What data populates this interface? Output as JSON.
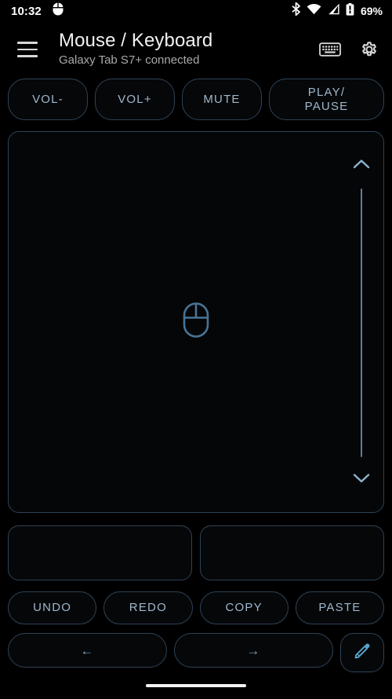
{
  "status_bar": {
    "time": "10:32",
    "battery_percent": "69%",
    "icons": {
      "notification": "mouse-icon",
      "bluetooth": "bluetooth-icon",
      "wifi": "wifi-icon",
      "cellular": "cellular-signal-icon",
      "battery": "battery-icon"
    }
  },
  "app_bar": {
    "menu_icon": "hamburger-menu-icon",
    "title": "Mouse / Keyboard",
    "subtitle": "Galaxy Tab S7+ connected",
    "actions": [
      {
        "name": "keyboard-icon",
        "label": "Keyboard"
      },
      {
        "name": "gear-icon",
        "label": "Settings"
      }
    ]
  },
  "media_row": {
    "vol_down": "VOL-",
    "vol_up": "VOL+",
    "mute": "MUTE",
    "play_pause": "PLAY/\nPAUSE"
  },
  "trackpad": {
    "mouse_icon": "mouse-icon",
    "scroll": {
      "up_icon": "chevron-up-icon",
      "down_icon": "chevron-down-icon"
    }
  },
  "click_row": {
    "left_click": "",
    "right_click": ""
  },
  "edit_row": {
    "undo": "UNDO",
    "redo": "REDO",
    "copy": "COPY",
    "paste": "PASTE"
  },
  "nav_row": {
    "back": "←",
    "forward": "→",
    "pencil_icon": "pencil-icon"
  },
  "colors": {
    "background": "#000000",
    "accent": "#7fa7c4",
    "border": "#2f4356",
    "title_text": "#f1f1f1",
    "subtitle_text": "#a9a9a9",
    "button_text": "#9fb8cc",
    "scroll_track": "#5e7f99"
  }
}
